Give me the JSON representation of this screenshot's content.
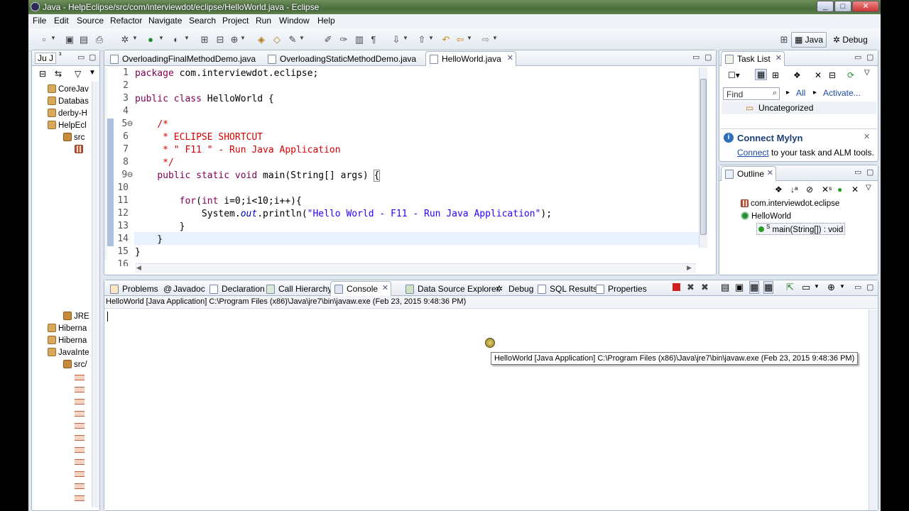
{
  "window": {
    "title": "Java - HelpEclipse/src/com/interviewdot/eclipse/HelloWorld.java - Eclipse",
    "min": "_",
    "max": "□",
    "close": "✕"
  },
  "menu": [
    "File",
    "Edit",
    "Source",
    "Refactor",
    "Navigate",
    "Search",
    "Project",
    "Run",
    "Window",
    "Help"
  ],
  "perspectives": {
    "java": "Java",
    "debug": "Debug"
  },
  "sidebar": {
    "tab_label": "Ju J",
    "tab_count": "³",
    "items": [
      "CoreJav",
      "Databas",
      "derby-H",
      "HelpEcl",
      "src",
      "",
      "",
      "JRE",
      "Hiberna",
      "Hiberna",
      "JavaInte",
      "src/"
    ]
  },
  "editor": {
    "tabs": [
      "OverloadingFinalMethodDemo.java",
      "OverloadingStaticMethodDemo.java",
      "HelloWorld.java"
    ],
    "lines": [
      "1",
      "2",
      "3",
      "4",
      "5⊖",
      "6",
      "7",
      "8",
      "9⊖",
      "10",
      "11",
      "12",
      "13",
      "14",
      "15",
      "16"
    ]
  },
  "tasklist": {
    "title": "Task List",
    "find_placeholder": "Find",
    "all": "All",
    "activate": "Activate...",
    "uncategorized": "Uncategorized",
    "mylyn_title": "Connect Mylyn",
    "mylyn_link": "Connect",
    "mylyn_text": " to your task and ALM tools."
  },
  "outline": {
    "title": "Outline",
    "items": [
      "com.interviewdot.eclipse",
      "HelloWorld",
      "main(String[]) : void"
    ]
  },
  "bottom": {
    "tabs": [
      "Problems",
      "Javadoc",
      "Declaration",
      "Call Hierarchy",
      "Console",
      "Data Source Explorer",
      "Debug",
      "SQL Results",
      "Properties"
    ],
    "console_header": "HelloWorld [Java Application] C:\\Program Files (x86)\\Java\\jre7\\bin\\javaw.exe (Feb 23, 2015 9:48:36 PM)",
    "tooltip": "HelloWorld [Java Application] C:\\Program Files (x86)\\Java\\jre7\\bin\\javaw.exe (Feb 23, 2015 9:48:36 PM)"
  }
}
